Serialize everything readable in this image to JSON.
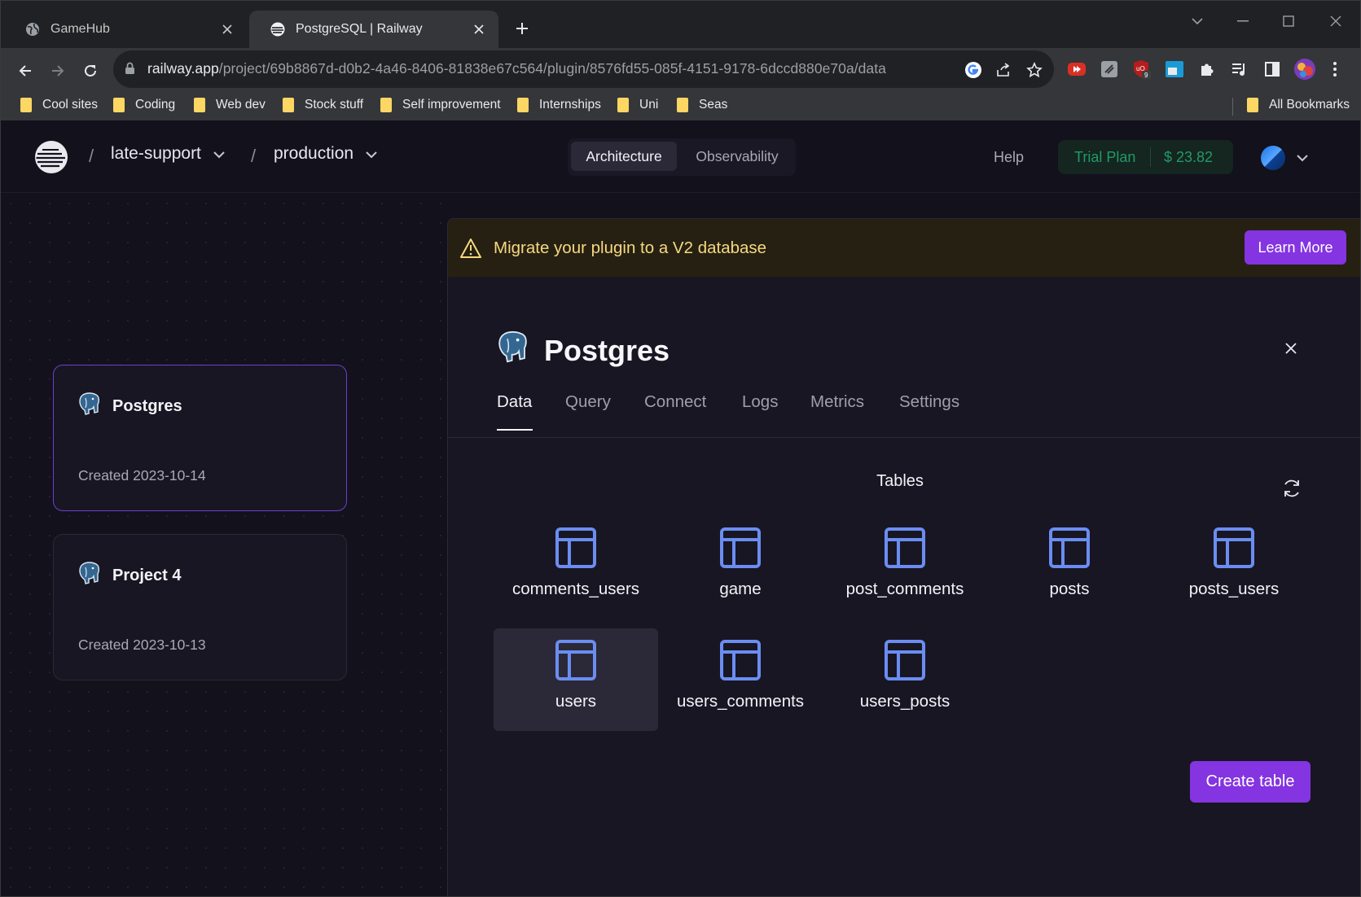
{
  "browser": {
    "tabs": [
      {
        "title": "GameHub",
        "favicon": "globe-icon",
        "active": false
      },
      {
        "title": "PostgreSQL | Railway",
        "favicon": "railway-icon",
        "active": true
      }
    ],
    "url_host": "railway.app",
    "url_path": "/project/69b8867d-d0b2-4a46-8406-81838e67c564/plugin/8576fd55-085f-4151-9178-6dccd880e70a/data",
    "extension_badge": "9",
    "bookmarks": [
      "Cool sites",
      "Coding",
      "Web dev",
      "Stock stuff",
      "Self improvement",
      "Internships",
      "Uni",
      "Seas"
    ],
    "all_bookmarks": "All Bookmarks"
  },
  "app": {
    "project": "late-support",
    "environment": "production",
    "breadcrumb_sep": "/",
    "views": [
      "Architecture",
      "Observability"
    ],
    "help": "Help",
    "plan": "Trial Plan",
    "credit": "$ 23.82"
  },
  "canvas": {
    "services": [
      {
        "name": "Postgres",
        "created": "Created 2023-10-14",
        "selected": true
      },
      {
        "name": "Project 4",
        "created": "Created 2023-10-13",
        "selected": false
      }
    ]
  },
  "panel": {
    "banner_text": "Migrate your plugin to a V2 database",
    "banner_button": "Learn More",
    "title": "Postgres",
    "tabs": [
      "Data",
      "Query",
      "Connect",
      "Logs",
      "Metrics",
      "Settings"
    ],
    "active_tab": "Data",
    "tables_heading": "Tables",
    "tables": [
      "comments_users",
      "game",
      "post_comments",
      "posts",
      "posts_users",
      "users",
      "users_comments",
      "users_posts"
    ],
    "selected_table": "users",
    "create_button": "Create table"
  },
  "colors": {
    "accent": "#8434e0",
    "table_icon": "#6b8df2",
    "warning_text": "#f6d87f",
    "plan_green": "#1f9b68"
  }
}
